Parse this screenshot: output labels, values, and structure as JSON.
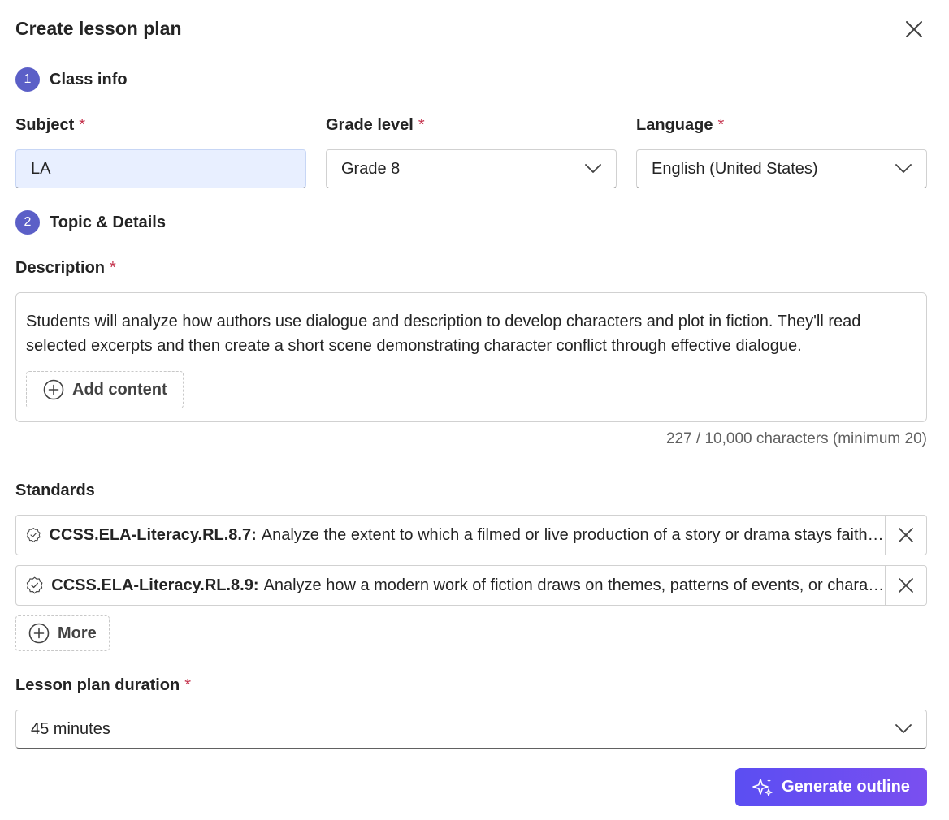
{
  "dialog": {
    "title": "Create lesson plan"
  },
  "steps": [
    {
      "number": "1",
      "label": "Class info"
    },
    {
      "number": "2",
      "label": "Topic & Details"
    }
  ],
  "required_mark": "*",
  "class_info": {
    "subject": {
      "label": "Subject",
      "value": "LA"
    },
    "grade": {
      "label": "Grade level",
      "value": "Grade 8"
    },
    "language": {
      "label": "Language",
      "value": "English (United States)"
    }
  },
  "details": {
    "description_label": "Description",
    "description_text": "Students will analyze how authors use dialogue and description to develop characters and plot in fiction. They'll read selected excerpts and then create a short scene demonstrating character conflict through effective dialogue.",
    "add_content_label": "Add content",
    "char_count": "227 / 10,000 characters (minimum 20)"
  },
  "standards": {
    "label": "Standards",
    "items": [
      {
        "code": "CCSS.ELA-Literacy.RL.8.7:",
        "description": "Analyze the extent to which a filmed or live production of a story or drama stays faithful to or departs from the text or script"
      },
      {
        "code": "CCSS.ELA-Literacy.RL.8.9:",
        "description": "Analyze how a modern work of fiction draws on themes, patterns of events, or character types from myths"
      }
    ],
    "more_label": "More"
  },
  "duration": {
    "label": "Lesson plan duration",
    "value": "45 minutes"
  },
  "actions": {
    "generate_label": "Generate outline"
  },
  "colors": {
    "accent": "#5b5fc7",
    "required": "#c4314b",
    "button_start": "#5b4ef2",
    "button_end": "#7a4ff0"
  },
  "icons": {
    "close": "close-icon",
    "chevron": "chevron-down-icon",
    "add": "add-circle-icon",
    "badge": "certificate-badge-icon",
    "sparkle": "sparkle-icon"
  }
}
